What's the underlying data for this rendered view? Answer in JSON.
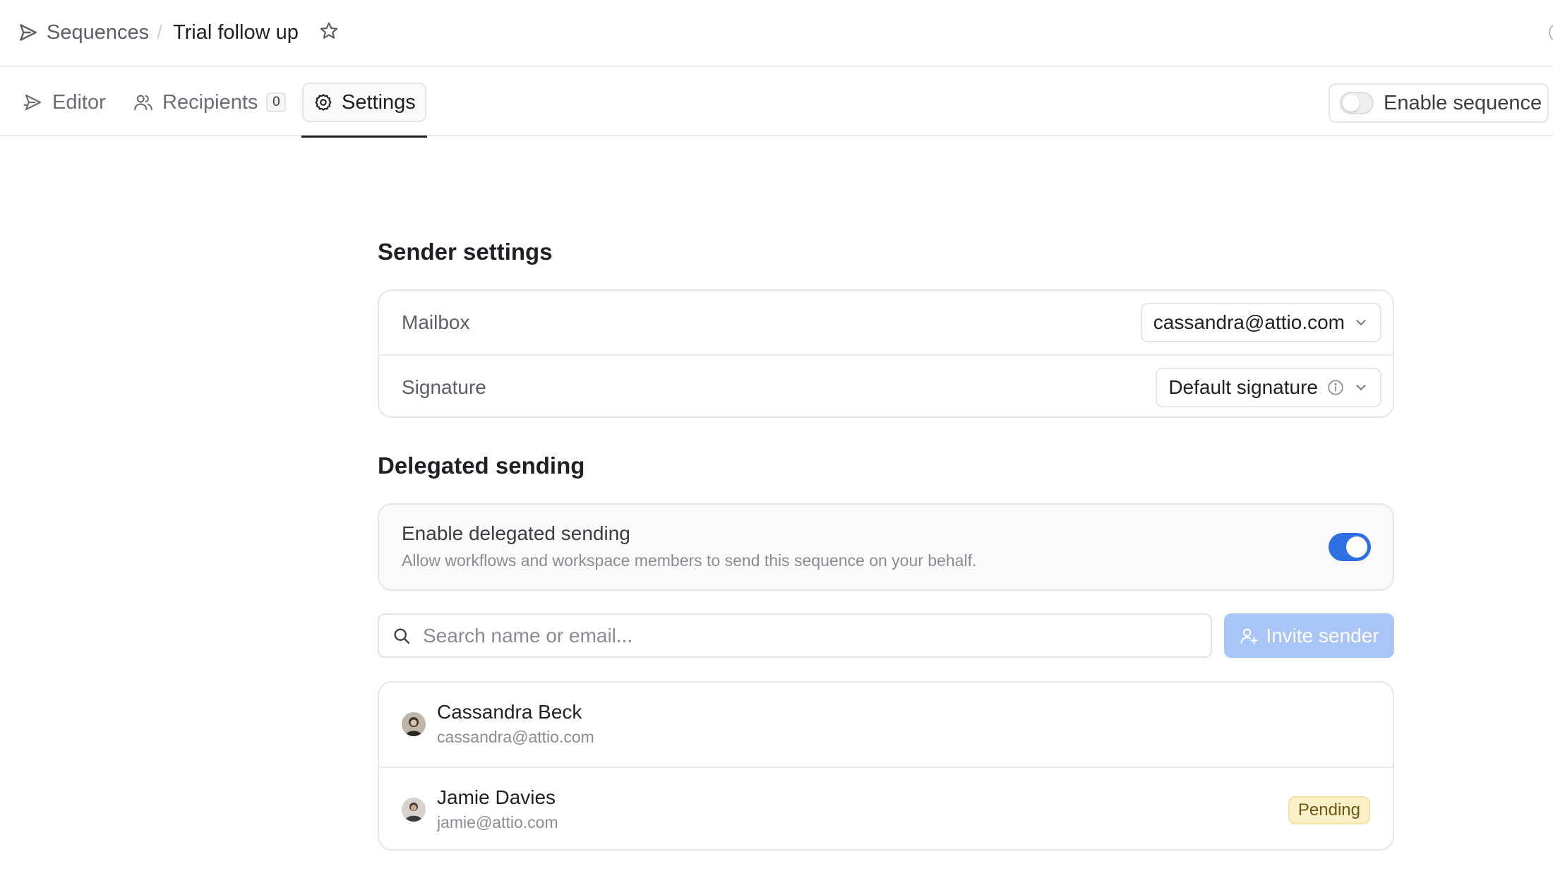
{
  "breadcrumb": {
    "root": "Sequences",
    "separator": "/",
    "current": "Trial follow up"
  },
  "tabs": [
    {
      "label": "Editor"
    },
    {
      "label": "Recipients",
      "count": "0"
    },
    {
      "label": "Settings",
      "active": true
    }
  ],
  "enable_sequence": {
    "label": "Enable sequence",
    "enabled": false
  },
  "sender_settings": {
    "title": "Sender settings",
    "mailbox": {
      "label": "Mailbox",
      "value": "cassandra@attio.com"
    },
    "signature": {
      "label": "Signature",
      "value": "Default signature"
    }
  },
  "delegated": {
    "title": "Delegated sending",
    "toggle_title": "Enable delegated sending",
    "toggle_description": "Allow workflows and workspace members to send this sequence on your behalf.",
    "enabled": true,
    "search_placeholder": "Search name or email...",
    "invite_label": "Invite sender",
    "members": [
      {
        "name": "Cassandra Beck",
        "email": "cassandra@attio.com",
        "status": ""
      },
      {
        "name": "Jamie Davies",
        "email": "jamie@attio.com",
        "status": "Pending"
      }
    ]
  },
  "colors": {
    "accent": "#2f6fe4",
    "invite_disabled": "#a9c5f7",
    "pending_bg": "#fbf1c8"
  }
}
